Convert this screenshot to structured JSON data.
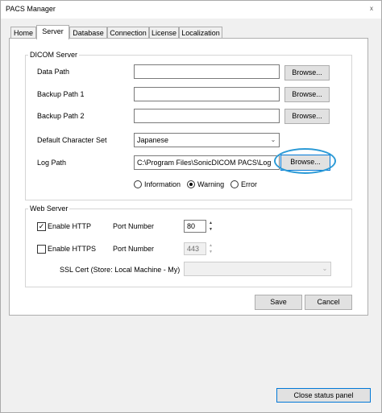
{
  "window": {
    "title": "PACS Manager",
    "close_glyph": "x"
  },
  "tabs": [
    {
      "label": "Home"
    },
    {
      "label": "Server",
      "active": true
    },
    {
      "label": "Database"
    },
    {
      "label": "Connection"
    },
    {
      "label": "License"
    },
    {
      "label": "Localization"
    }
  ],
  "dicom": {
    "group_title": "DICOM Server",
    "data_path_label": "Data Path",
    "data_path_value": "",
    "backup1_label": "Backup Path 1",
    "backup1_value": "",
    "backup2_label": "Backup Path 2",
    "backup2_value": "",
    "browse_label": "Browse...",
    "charset_label": "Default Character Set",
    "charset_value": "Japanese",
    "log_path_label": "Log Path",
    "log_path_value": "C:\\Program Files\\SonicDICOM PACS\\Log",
    "log_levels": [
      {
        "label": "Information",
        "selected": false
      },
      {
        "label": "Warning",
        "selected": true
      },
      {
        "label": "Error",
        "selected": false
      }
    ]
  },
  "web": {
    "group_title": "Web Server",
    "http_label": "Enable HTTP",
    "http_checked": true,
    "https_label": "Enable HTTPS",
    "https_checked": false,
    "port_label": "Port Number",
    "http_port": "80",
    "https_port": "443",
    "ssl_label": "SSL Cert (Store: Local Machine - My)",
    "ssl_value": ""
  },
  "actions": {
    "save_label": "Save",
    "cancel_label": "Cancel",
    "close_status_label": "Close status panel"
  },
  "colors": {
    "highlight": "#2b9ad6",
    "focus_border": "#0078d7"
  }
}
